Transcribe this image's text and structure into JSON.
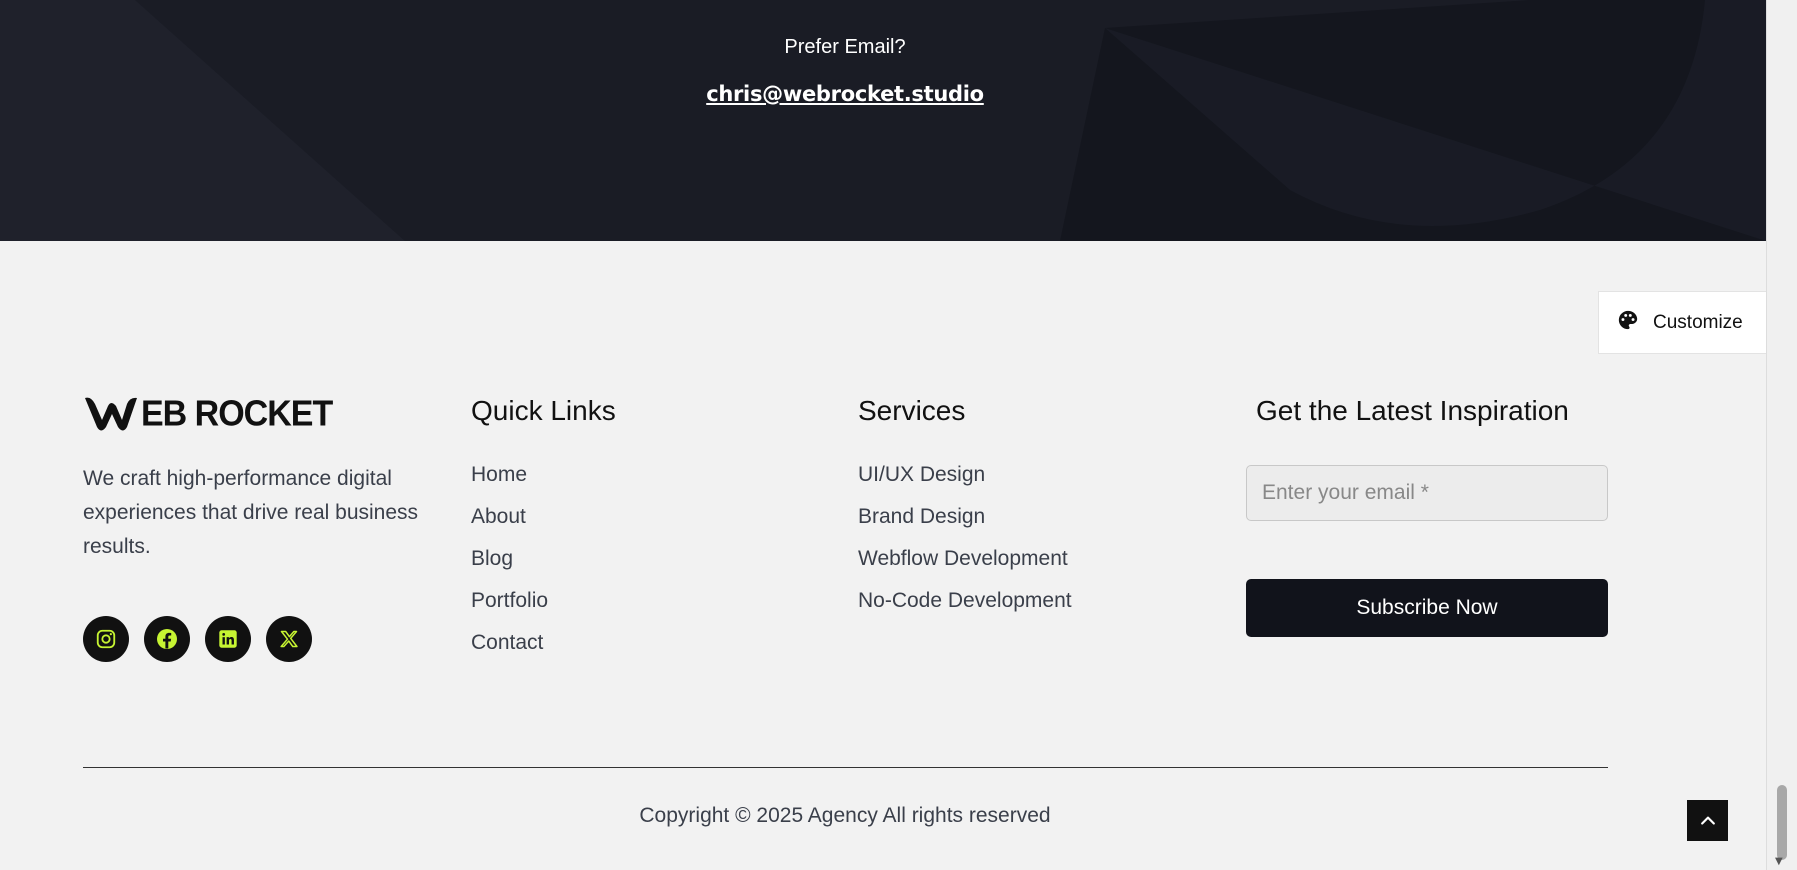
{
  "hero": {
    "prefer_text": "Prefer Email?",
    "email": "chris@webrocket.studio"
  },
  "customize": {
    "label": "Customize",
    "icon": "palette-icon"
  },
  "brand": {
    "logo_text": "EB ROCKET",
    "logo_mark": "W",
    "tagline": "We craft high-performance digital experiences that drive real business results.",
    "socials": [
      "instagram-icon",
      "facebook-icon",
      "linkedin-icon",
      "x-icon"
    ],
    "social_icon_color": "#c6f432"
  },
  "quick_links": {
    "title": "Quick Links",
    "items": [
      "Home",
      "About",
      "Blog",
      "Portfolio",
      "Contact"
    ]
  },
  "services": {
    "title": "Services",
    "items": [
      "UI/UX Design",
      "Brand Design",
      "Webflow Development",
      "No-Code Development"
    ]
  },
  "newsletter": {
    "title": "Get the Latest Inspiration",
    "placeholder": "Enter your email *",
    "button": "Subscribe Now"
  },
  "footer": {
    "copyright": "Copyright © 2025 Agency All rights reserved"
  },
  "colors": {
    "dark": "#1f212b",
    "accent": "#c6f432",
    "bg": "#f2f2f2"
  }
}
